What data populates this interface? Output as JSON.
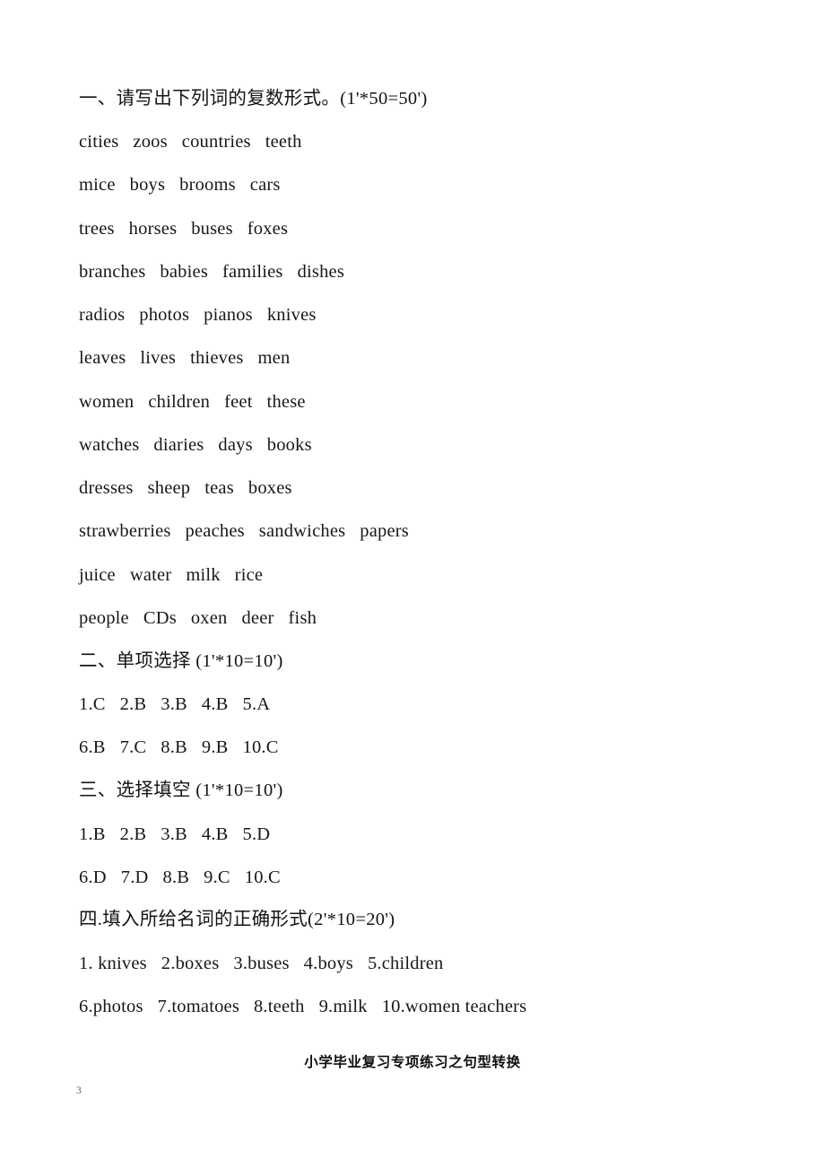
{
  "document": {
    "page_number": "3",
    "footer_title": "小学毕业复习专项练习之句型转换"
  },
  "sections": [
    {
      "id": "section-1",
      "heading": "一、请写出下列词的复数形式。(1'*50=50')",
      "lines": [
        "cities   zoos   countries   teeth",
        "mice   boys   brooms   cars",
        "trees   horses   buses   foxes",
        "branches   babies   families   dishes",
        "radios   photos   pianos   knives",
        "leaves   lives   thieves   men",
        "women   children   feet   these",
        "watches   diaries   days   books",
        "dresses   sheep   teas   boxes",
        "strawberries   peaches   sandwiches   papers",
        "juice   water   milk   rice",
        "people   CDs   oxen   deer   fish"
      ]
    },
    {
      "id": "section-2",
      "heading": "二、单项选择 (1'*10=10')",
      "lines": [
        "1.C   2.B   3.B   4.B   5.A",
        "6.B   7.C   8.B   9.B   10.C"
      ]
    },
    {
      "id": "section-3",
      "heading": "三、选择填空 (1'*10=10')",
      "lines": [
        "1.B   2.B   3.B   4.B   5.D",
        "6.D   7.D   8.B   9.C   10.C"
      ]
    },
    {
      "id": "section-4",
      "heading": "四.填入所给名词的正确形式(2'*10=20')",
      "lines": [
        "1. knives   2.boxes   3.buses   4.boys   5.children",
        "6.photos   7.tomatoes   8.teeth   9.milk   10.women teachers"
      ]
    }
  ],
  "layout": {
    "line_tops": {
      "s1_heading": 100,
      "s1_lines": [
        148,
        196,
        245,
        293,
        341,
        389,
        438,
        486,
        534,
        582,
        631,
        679
      ],
      "s2_heading": 727,
      "s2_lines": [
        775,
        823
      ],
      "s3_heading": 871,
      "s3_lines": [
        920,
        968
      ],
      "s4_heading": 1015,
      "s4_lines": [
        1064,
        1112
      ],
      "footer_title": 1172,
      "page_number": 1210
    }
  }
}
